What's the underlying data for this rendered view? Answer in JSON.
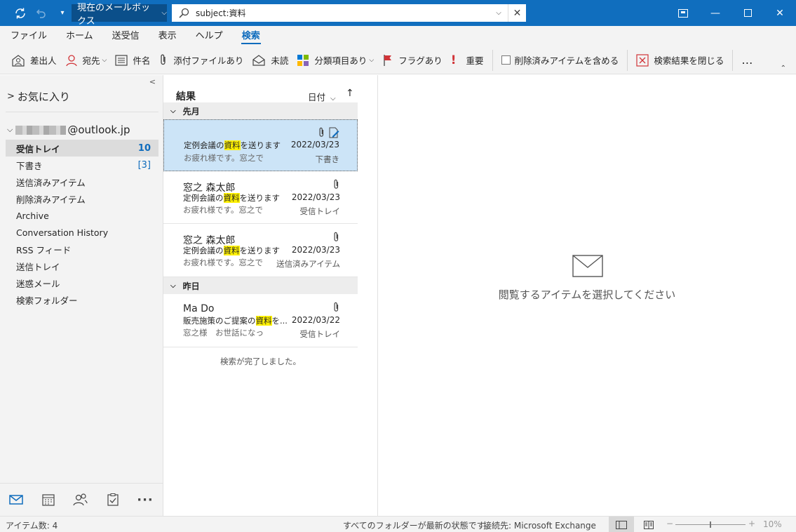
{
  "titlebar": {
    "scope_label": "現在のメールボックス",
    "search_query": "subject:資料"
  },
  "menu": {
    "tabs": [
      {
        "label": "ファイル"
      },
      {
        "label": "ホーム"
      },
      {
        "label": "送受信"
      },
      {
        "label": "表示"
      },
      {
        "label": "ヘルプ"
      },
      {
        "label": "検索",
        "active": true
      }
    ]
  },
  "ribbon": {
    "from": "差出人",
    "to": "宛先",
    "subject": "件名",
    "has_attachments": "添付ファイルあり",
    "unread": "未読",
    "categorized": "分類項目あり",
    "flagged": "フラグあり",
    "important": "重要",
    "include_deleted": "削除済みアイテムを含める",
    "close_search": "検索結果を閉じる",
    "more": "…"
  },
  "folders": {
    "favorites": "お気に入り",
    "account_suffix": "@outlook.jp",
    "items": [
      {
        "label": "受信トレイ",
        "count": "10",
        "selected": true
      },
      {
        "label": "下書き",
        "count": "[3]"
      },
      {
        "label": "送信済みアイテム",
        "count": ""
      },
      {
        "label": "削除済みアイテム",
        "count": ""
      },
      {
        "label": "Archive",
        "count": ""
      },
      {
        "label": "Conversation History",
        "count": ""
      },
      {
        "label": "RSS フィード",
        "count": ""
      },
      {
        "label": "送信トレイ",
        "count": ""
      },
      {
        "label": "迷惑メール",
        "count": ""
      },
      {
        "label": "検索フォルダー",
        "count": ""
      }
    ]
  },
  "msglist": {
    "title": "結果",
    "sort_label": "日付",
    "sort_arrow": "↑",
    "groups": [
      {
        "label": "先月"
      },
      {
        "label": "昨日"
      }
    ],
    "messages": [
      {
        "from": "",
        "subj_pre": "定例会議の",
        "subj_hl": "資料",
        "subj_post": "を送ります",
        "date": "2022/03/23",
        "preview": "お疲れ様です。窓之で",
        "folder": "下書き",
        "selected": true
      },
      {
        "from": "窓之 森太郎",
        "subj_pre": "定例会議の",
        "subj_hl": "資料",
        "subj_post": "を送ります",
        "date": "2022/03/23",
        "preview": "お疲れ様です。窓之で",
        "folder": "受信トレイ"
      },
      {
        "from": "窓之 森太郎",
        "subj_pre": "定例会議の",
        "subj_hl": "資料",
        "subj_post": "を送ります",
        "date": "2022/03/23",
        "preview": "お疲れ様です。窓之で",
        "folder": "送信済みアイテム"
      },
      {
        "from": "Ma Do",
        "subj_pre": "販売施策のご提案の",
        "subj_hl": "資料",
        "subj_post": "を...",
        "date": "2022/03/22",
        "preview": "窓之様　お世話になっ",
        "folder": "受信トレイ"
      }
    ],
    "complete": "検索が完了しました。"
  },
  "reading": {
    "empty_text": "閲覧するアイテムを選択してください"
  },
  "status": {
    "item_count": "アイテム数: 4",
    "uptodate": "すべてのフォルダーが最新の状態です。",
    "connection": "接続先: Microsoft Exchange",
    "zoom": "10%"
  },
  "colors": {
    "titlebar": "#106ebe",
    "accent": "#0f6cbd",
    "selected_message": "#cce4f7",
    "highlight": "#fff100"
  }
}
